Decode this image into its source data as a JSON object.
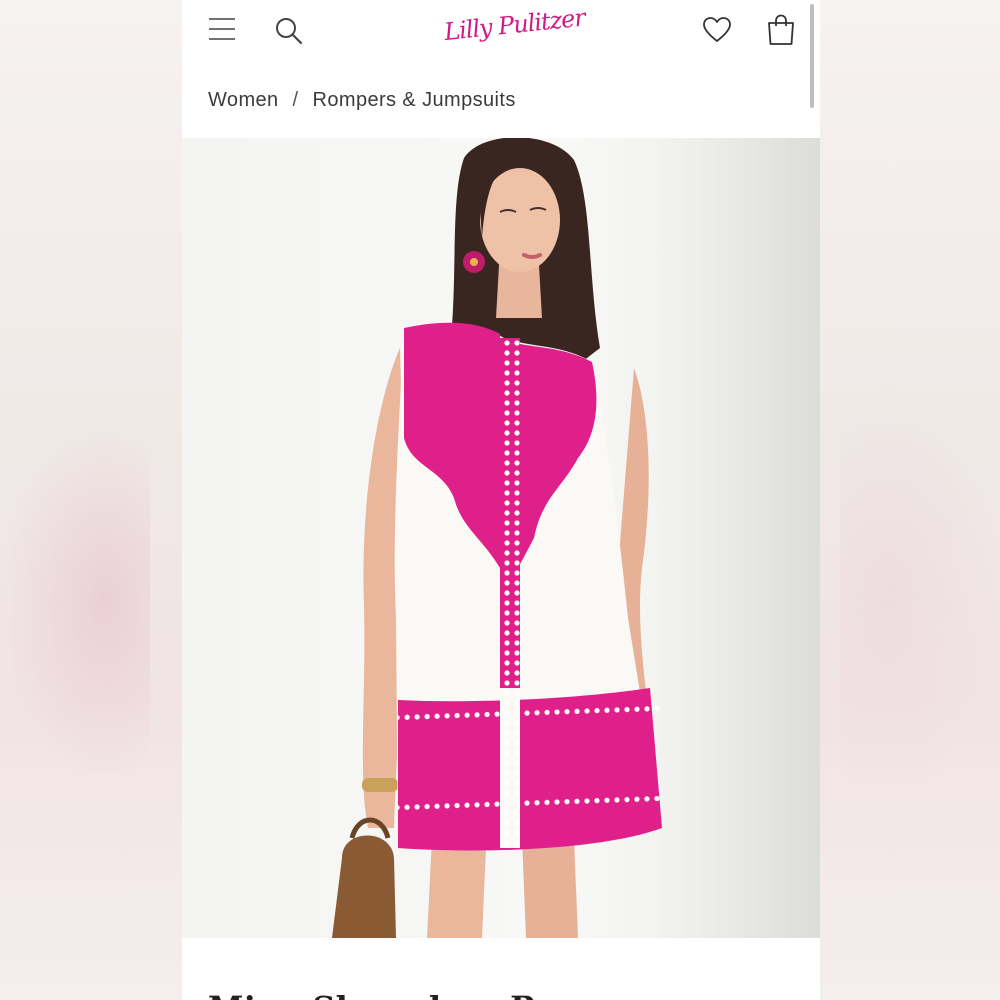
{
  "brand": {
    "logo_text": "Lilly Pulitzer",
    "accent": "#d21a86"
  },
  "header": {
    "icons": [
      "menu-icon",
      "search-icon",
      "heart-icon",
      "shopping-bag-icon"
    ]
  },
  "breadcrumb": {
    "items": [
      "Women",
      "Rompers & Jumpsuits"
    ],
    "separator": "/"
  },
  "product": {
    "title": "Mina Sleeveless Romper",
    "image_alt": "Model wearing white sleeveless romper with pink embroidered print"
  },
  "colors": {
    "print_pink": "#e0208a",
    "dress_white": "#fbf9f6",
    "text_dark": "#222222"
  }
}
